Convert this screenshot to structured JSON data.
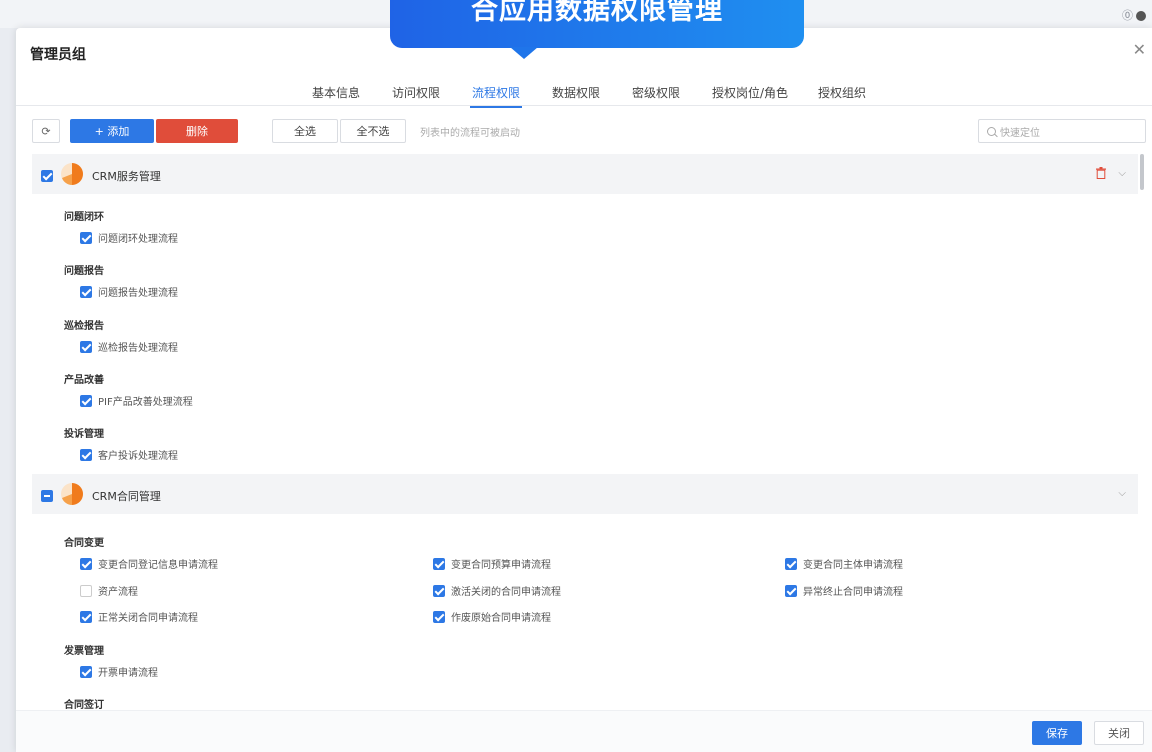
{
  "banner": {
    "title": "合应用数据权限管理",
    "color": "#1f7aec"
  },
  "dialog": {
    "title": "管理员组",
    "close_icon": "close-icon"
  },
  "tabs": [
    {
      "label": "基本信息"
    },
    {
      "label": "访问权限"
    },
    {
      "label": "流程权限",
      "active": true
    },
    {
      "label": "数据权限"
    },
    {
      "label": "密级权限"
    },
    {
      "label": "授权岗位/角色"
    },
    {
      "label": "授权组织"
    }
  ],
  "toolbar": {
    "add_label": "+ 添加",
    "delete_label": "删除",
    "select_all_label": "全选",
    "select_none_label": "全不选",
    "hint": "列表中的流程可被启动",
    "search_placeholder": "快速定位"
  },
  "groups": [
    {
      "title": "CRM服务管理",
      "state": "checked",
      "categories": [
        {
          "name": "问题闭环",
          "items": [
            {
              "label": "问题闭环处理流程",
              "checked": true
            }
          ]
        },
        {
          "name": "问题报告",
          "items": [
            {
              "label": "问题报告处理流程",
              "checked": true
            }
          ]
        },
        {
          "name": "巡检报告",
          "items": [
            {
              "label": "巡检报告处理流程",
              "checked": true
            }
          ]
        },
        {
          "name": "产品改善",
          "items": [
            {
              "label": "PIF产品改善处理流程",
              "checked": true
            }
          ]
        },
        {
          "name": "投诉管理",
          "items": [
            {
              "label": "客户投诉处理流程",
              "checked": true
            }
          ]
        }
      ]
    },
    {
      "title": "CRM合同管理",
      "state": "partial",
      "categories": [
        {
          "name": "合同变更",
          "items": [
            {
              "label": "变更合同登记信息申请流程",
              "checked": true
            },
            {
              "label": "变更合同预算申请流程",
              "checked": true
            },
            {
              "label": "变更合同主体申请流程",
              "checked": true
            },
            {
              "label": "资产流程",
              "checked": false
            },
            {
              "label": "激活关闭的合同申请流程",
              "checked": true
            },
            {
              "label": "异常终止合同申请流程",
              "checked": true
            },
            {
              "label": "正常关闭合同申请流程",
              "checked": true
            },
            {
              "label": "作废原始合同申请流程",
              "checked": true
            }
          ]
        },
        {
          "name": "发票管理",
          "items": [
            {
              "label": "开票申请流程",
              "checked": true
            }
          ]
        },
        {
          "name": "合同签订",
          "items": []
        }
      ]
    }
  ],
  "footer": {
    "save_label": "保存",
    "close_label": "关闭"
  },
  "colors": {
    "primary": "#2d78e5",
    "danger": "#e04d3a"
  }
}
